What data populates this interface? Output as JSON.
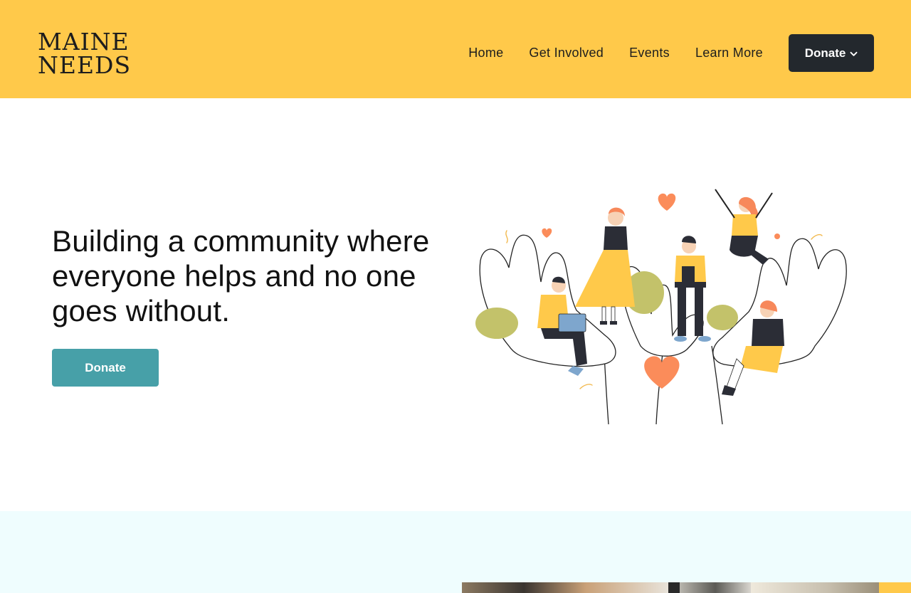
{
  "brand": {
    "line1": "MAINE",
    "line2": "NEEDS"
  },
  "nav": {
    "items": [
      {
        "label": "Home"
      },
      {
        "label": "Get Involved"
      },
      {
        "label": "Events"
      },
      {
        "label": "Learn More"
      }
    ],
    "donate_label": "Donate",
    "donate_icon": "chevron-down-icon"
  },
  "hero": {
    "headline": "Building a community where everyone helps and no one goes without.",
    "donate_label": "Donate"
  },
  "colors": {
    "header_bg": "#ffc94a",
    "dark_button": "#23282d",
    "teal_button": "#47a0a8",
    "band_bg": "#effdfe",
    "heart": "#fb8c5a",
    "leaf": "#c3c26a"
  }
}
